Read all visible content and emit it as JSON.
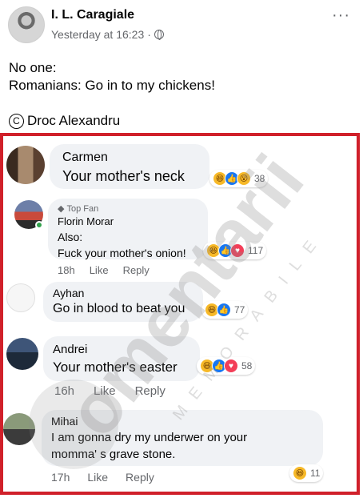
{
  "post": {
    "author": "I. L. Caragiale",
    "timestamp": "Yesterday at 16:23",
    "separator": "·",
    "more_icon": "···",
    "lines": [
      "No one:",
      "Romanians: Go in to my chickens!"
    ],
    "copyright_symbol": "C",
    "credit": "Droc Alexandru"
  },
  "watermark": {
    "main": "omentarii",
    "sub": "MEMORABILE"
  },
  "comments": [
    {
      "name": "Carmen",
      "text": "Your mother's neck",
      "reactions": [
        "haha",
        "like",
        "wow"
      ],
      "count": "38"
    },
    {
      "name": "Florin Morar",
      "badge": "Top Fan",
      "lines": [
        "Also:",
        "Fuck your mother's onion!"
      ],
      "time": "18h",
      "like": "Like",
      "reply": "Reply",
      "reactions": [
        "haha",
        "like",
        "love"
      ],
      "count": "117"
    },
    {
      "name": "Ayhan",
      "text": "Go in blood to beat you",
      "reactions": [
        "haha",
        "like"
      ],
      "count": "77"
    },
    {
      "name": "Andrei",
      "text": "Your mother's easter",
      "time": "16h",
      "like": "Like",
      "reply": "Reply",
      "reactions": [
        "haha",
        "like",
        "love"
      ],
      "count": "58"
    },
    {
      "name": "Mihai",
      "lines": [
        "I am gonna dry my underwer on your",
        "momma' s grave stone."
      ],
      "time": "17h",
      "like": "Like",
      "reply": "Reply",
      "reactions": [
        "haha"
      ],
      "count": "11"
    }
  ],
  "colors": {
    "frame": "#d0202a",
    "bubble": "#f0f2f5",
    "like": "#1877f2",
    "love": "#f33e58",
    "haha": "#f7b928"
  }
}
